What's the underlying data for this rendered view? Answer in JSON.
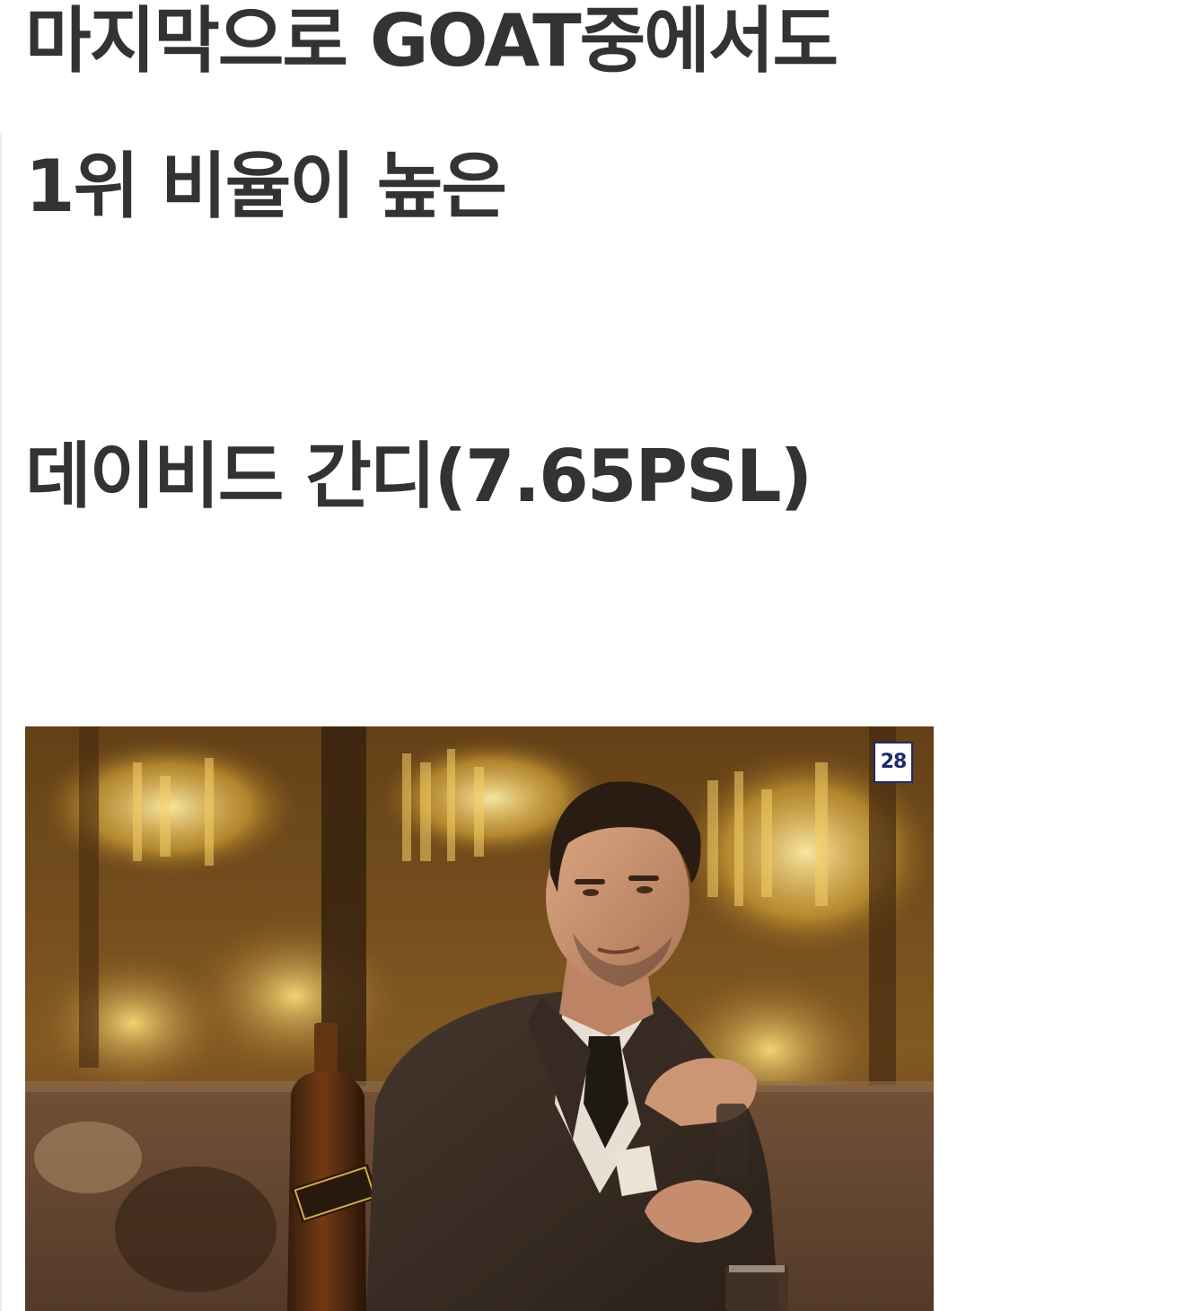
{
  "post": {
    "lines": [
      "마지막으로 GOAT중에서도",
      "1위 비율이 높은",
      "데이비드 간디(7.65PSL)"
    ]
  },
  "media": {
    "badge_label": "28"
  },
  "colors": {
    "text": "#333333",
    "badge_border": "#1f2a6b",
    "background": "#ffffff"
  }
}
